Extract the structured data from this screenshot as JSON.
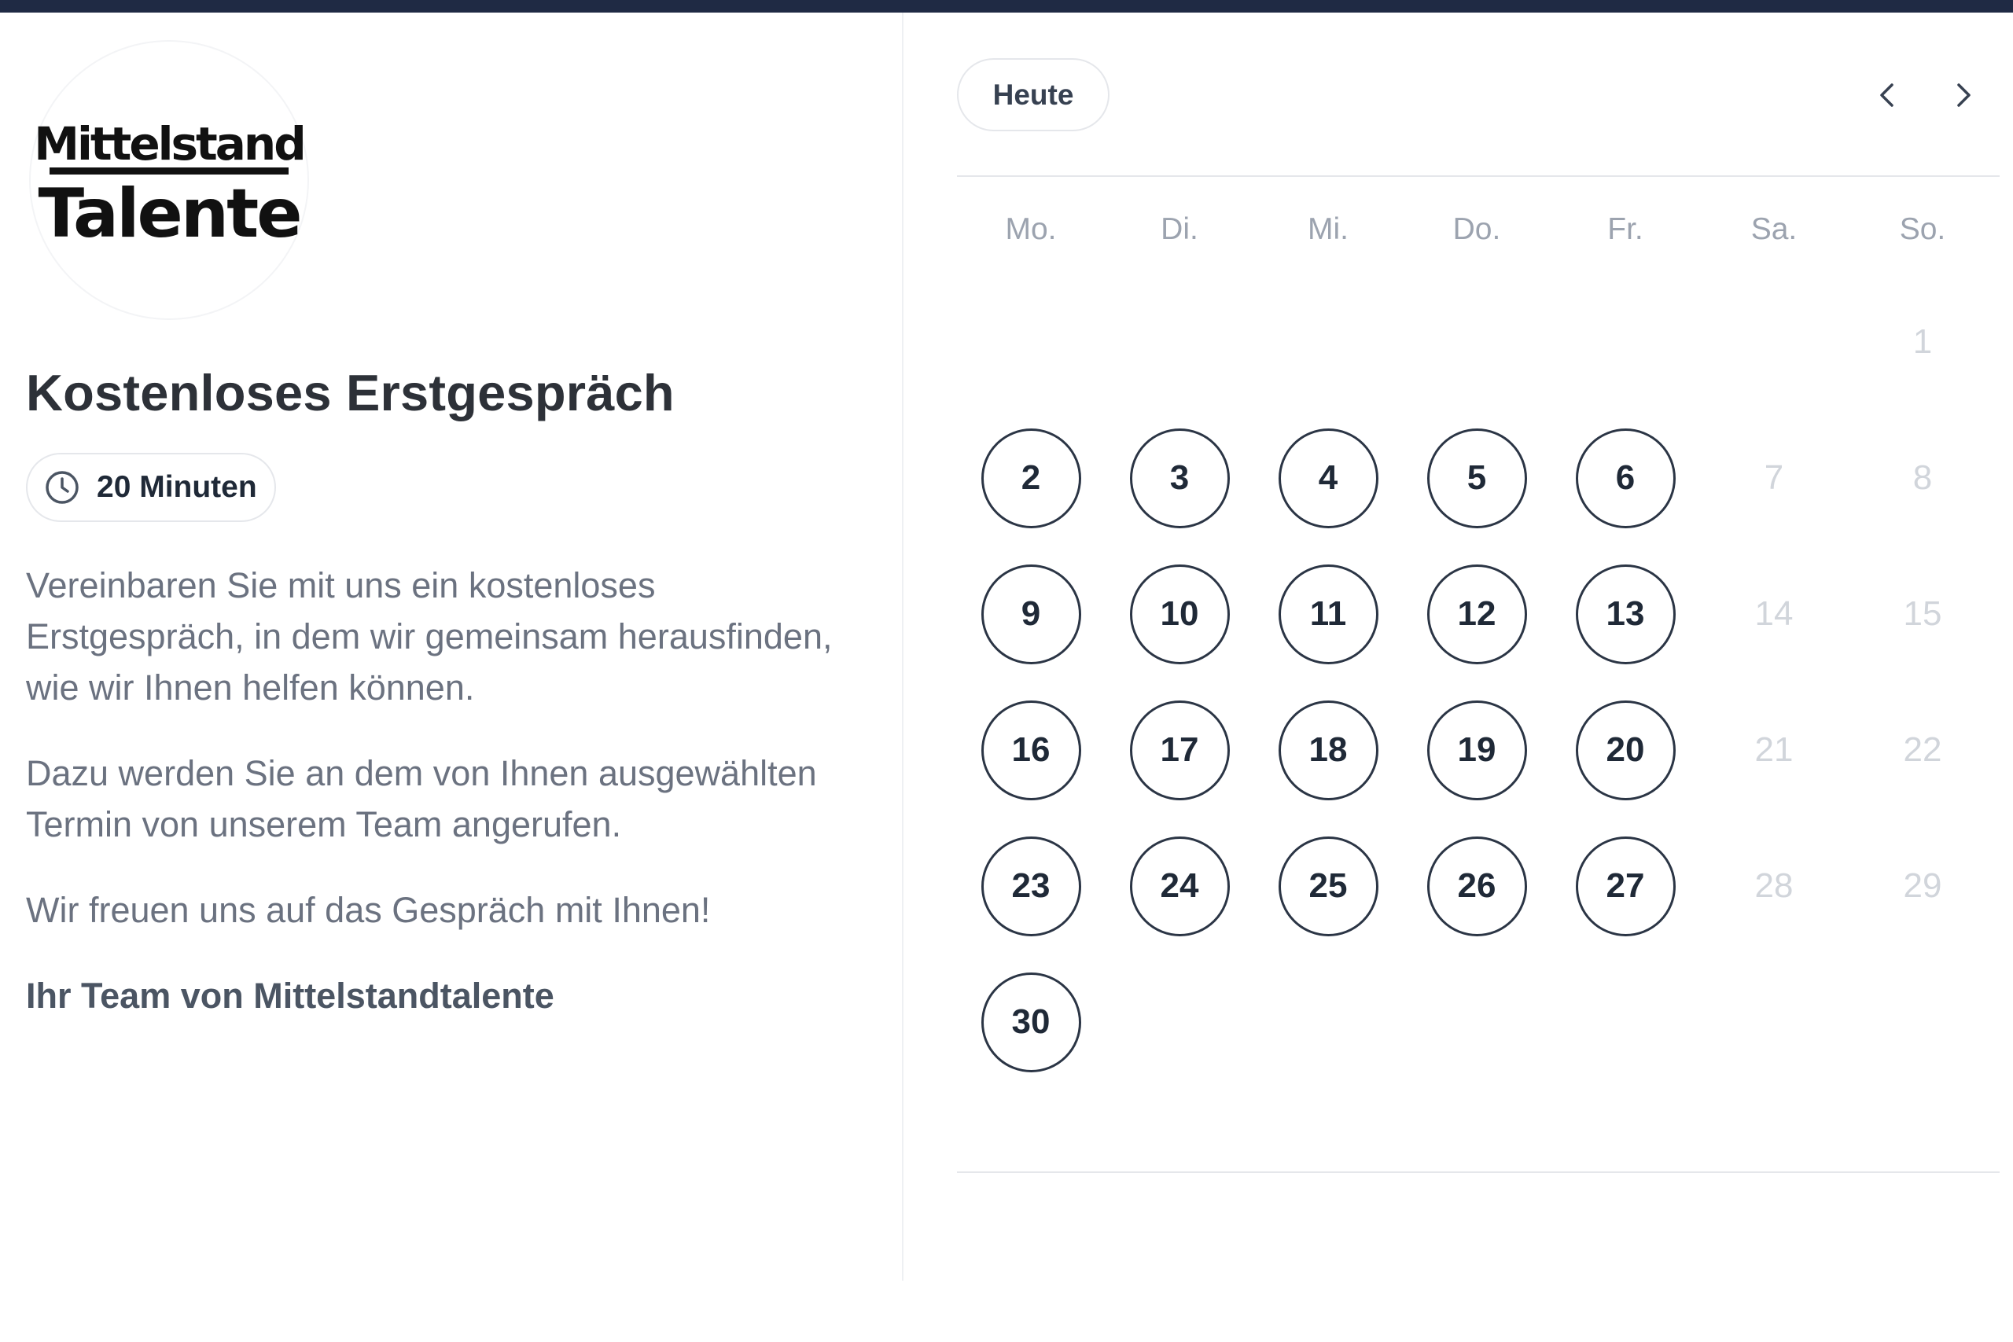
{
  "logo": {
    "lettering": "Mittelstand Talente"
  },
  "event": {
    "title": "Kostenloses Erstgespräch",
    "duration": "20 Minuten",
    "description": [
      "Vereinbaren Sie mit uns ein kostenloses Erstgespräch, in dem wir gemeinsam herausfinden, wie wir Ihnen helfen können.",
      "Dazu werden Sie an dem von Ihnen ausgewählten Termin von unserem Team angerufen.",
      "Wir freuen uns auf das Gespräch mit Ihnen!"
    ],
    "signature": "Ihr Team von Mittelstandtalente"
  },
  "calendar": {
    "today_label": "Heute",
    "prev_icon": "chevron-left-icon",
    "next_icon": "chevron-right-icon",
    "weekdays": [
      "Mo.",
      "Di.",
      "Mi.",
      "Do.",
      "Fr.",
      "Sa.",
      "So."
    ],
    "first_weekday_index": 6,
    "days": [
      {
        "label": "1",
        "available": false
      },
      {
        "label": "2",
        "available": true
      },
      {
        "label": "3",
        "available": true
      },
      {
        "label": "4",
        "available": true
      },
      {
        "label": "5",
        "available": true
      },
      {
        "label": "6",
        "available": true
      },
      {
        "label": "7",
        "available": false
      },
      {
        "label": "8",
        "available": false
      },
      {
        "label": "9",
        "available": true
      },
      {
        "label": "10",
        "available": true
      },
      {
        "label": "11",
        "available": true
      },
      {
        "label": "12",
        "available": true
      },
      {
        "label": "13",
        "available": true
      },
      {
        "label": "14",
        "available": false
      },
      {
        "label": "15",
        "available": false
      },
      {
        "label": "16",
        "available": true
      },
      {
        "label": "17",
        "available": true
      },
      {
        "label": "18",
        "available": true
      },
      {
        "label": "19",
        "available": true
      },
      {
        "label": "20",
        "available": true
      },
      {
        "label": "21",
        "available": false
      },
      {
        "label": "22",
        "available": false
      },
      {
        "label": "23",
        "available": true
      },
      {
        "label": "24",
        "available": true
      },
      {
        "label": "25",
        "available": true
      },
      {
        "label": "26",
        "available": true
      },
      {
        "label": "27",
        "available": true
      },
      {
        "label": "28",
        "available": false
      },
      {
        "label": "29",
        "available": false
      },
      {
        "label": "30",
        "available": true
      }
    ]
  },
  "colors": {
    "topbar": "#1f2a44",
    "available_border": "#2b3545",
    "unavailable_text": "#d1d5db"
  }
}
